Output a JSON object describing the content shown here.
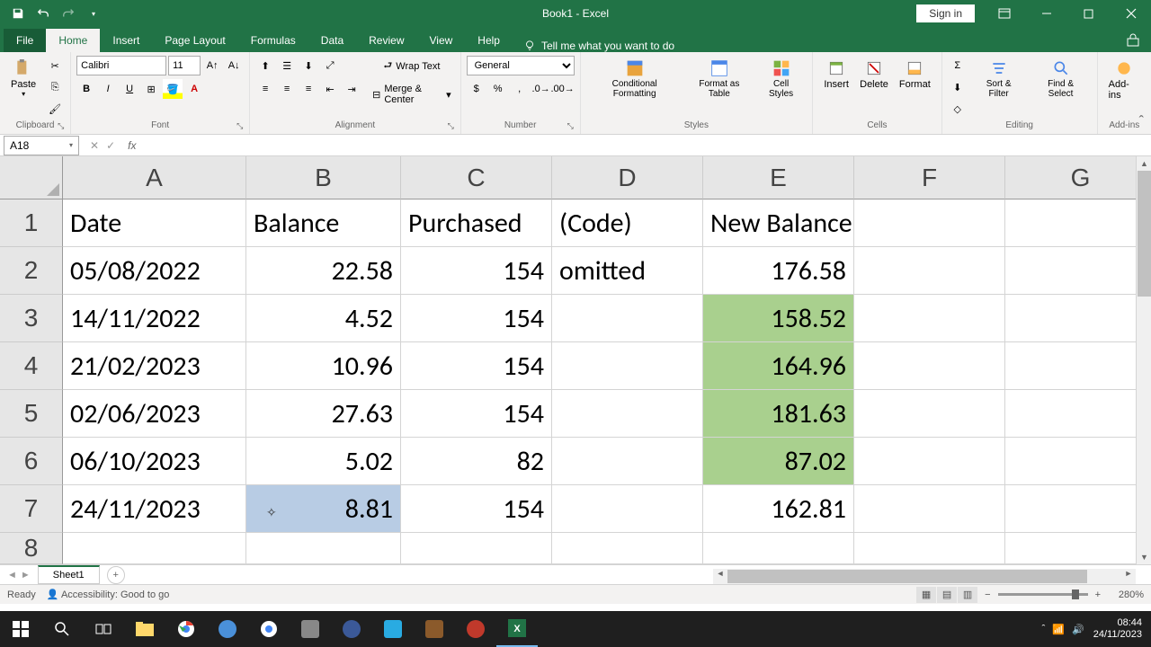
{
  "app": {
    "title": "Book1 - Excel",
    "signin": "Sign in"
  },
  "tabs": {
    "file": "File",
    "home": "Home",
    "insert": "Insert",
    "pageLayout": "Page Layout",
    "formulas": "Formulas",
    "data": "Data",
    "review": "Review",
    "view": "View",
    "help": "Help",
    "tellme": "Tell me what you want to do"
  },
  "ribbon": {
    "clipboard": {
      "label": "Clipboard",
      "paste": "Paste"
    },
    "font": {
      "label": "Font",
      "name": "Calibri",
      "size": "11"
    },
    "alignment": {
      "label": "Alignment",
      "wrap": "Wrap Text",
      "merge": "Merge & Center"
    },
    "number": {
      "label": "Number",
      "format": "General"
    },
    "styles": {
      "label": "Styles",
      "cond": "Conditional Formatting",
      "table": "Format as Table",
      "cell": "Cell Styles"
    },
    "cells": {
      "label": "Cells",
      "insert": "Insert",
      "delete": "Delete",
      "format": "Format"
    },
    "editing": {
      "label": "Editing",
      "sort": "Sort & Filter",
      "find": "Find & Select"
    },
    "addins": {
      "label": "Add-ins",
      "btn": "Add-ins"
    }
  },
  "namebox": "A18",
  "cols": [
    "A",
    "B",
    "C",
    "D",
    "E",
    "F",
    "G"
  ],
  "rows": [
    "1",
    "2",
    "3",
    "4",
    "5",
    "6",
    "7",
    "8"
  ],
  "cells": {
    "A1": "Date",
    "B1": "Balance",
    "C1": "Purchased",
    "D1": "(Code)",
    "E1": "New Balance",
    "A2": "05/08/2022",
    "B2": "22.58",
    "C2": "154",
    "D2": "omitted",
    "E2": "176.58",
    "A3": "14/11/2022",
    "B3": "4.52",
    "C3": "154",
    "E3": "158.52",
    "A4": "21/02/2023",
    "B4": "10.96",
    "C4": "154",
    "E4": "164.96",
    "A5": "02/06/2023",
    "B5": "27.63",
    "C5": "154",
    "E5": "181.63",
    "A6": "06/10/2023",
    "B6": "5.02",
    "C6": "82",
    "E6": "87.02",
    "A7": "24/11/2023",
    "B7": "8.81",
    "C7": "154",
    "E7": "162.81"
  },
  "sheet": {
    "name": "Sheet1"
  },
  "status": {
    "ready": "Ready",
    "access": "Accessibility: Good to go",
    "zoom": "280%"
  },
  "taskbar": {
    "time": "08:44",
    "date": "24/11/2023"
  }
}
